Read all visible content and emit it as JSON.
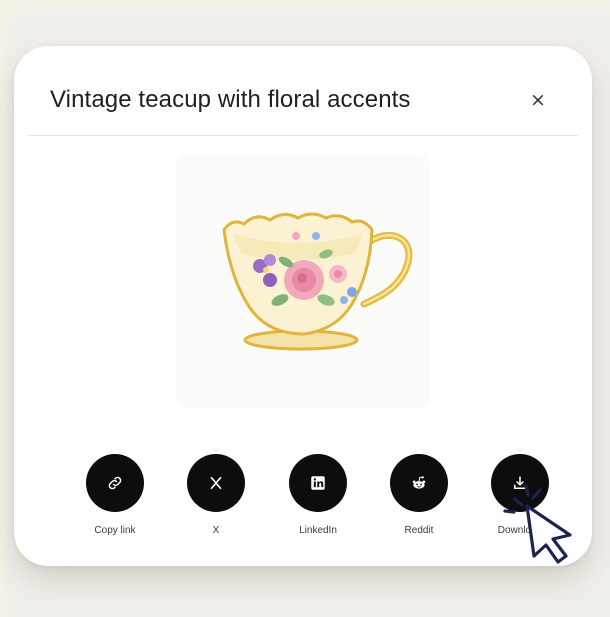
{
  "dialog": {
    "title": "Vintage teacup with floral accents",
    "close_glyph": "×"
  },
  "image": {
    "subject": "teacup-illustration"
  },
  "share_options": [
    {
      "label": "Copy link",
      "icon": "link-icon"
    },
    {
      "label": "X",
      "icon": "x-logo-icon"
    },
    {
      "label": "LinkedIn",
      "icon": "linkedin-icon"
    },
    {
      "label": "Reddit",
      "icon": "reddit-icon"
    },
    {
      "label": "Download",
      "icon": "download-icon"
    }
  ],
  "colors": {
    "page_background": "#f6f1e6",
    "modal_background": "#ffffff",
    "button_fill": "#0d0d0d",
    "cursor_stroke": "#1b2350"
  }
}
